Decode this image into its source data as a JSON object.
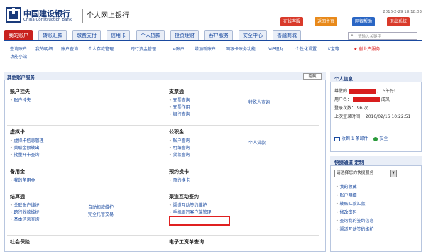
{
  "header": {
    "bank_cn": "中国建设银行",
    "bank_en": "China Construction Bank",
    "system_title": "个人网上银行",
    "date": "2016-2-29 18:18:03",
    "buttons": [
      "在线客服",
      "返回主页",
      "网银帮助",
      "退出系统"
    ]
  },
  "nav": {
    "tabs": [
      "我的账户",
      "转账汇款",
      "缴费支付",
      "信用卡",
      "个人贷款",
      "投资理财",
      "客户服务",
      "安全中心",
      "善融商城"
    ],
    "search_placeholder": "请输入关键字"
  },
  "subnav": {
    "items": [
      "查询账户",
      "我的明细",
      "账户查询",
      "个人存款管理",
      "跨行资金管理",
      "e账户",
      "增加新账户",
      "网银卡账务功能",
      "VIP理财",
      "个性化设置",
      "K宝等",
      "★ 创业产服务",
      "功能小站"
    ]
  },
  "main": {
    "title": "其他账户服务",
    "toggle_label": "隐藏",
    "sections": [
      {
        "title": "账户挂失",
        "links": [
          "账户挂失"
        ]
      },
      {
        "title": "支票通",
        "links": [
          "支票查询",
          "支票作用",
          "银行查询",
          "特殊人查询"
        ]
      },
      {
        "title": "虚拟卡",
        "links": [
          "虚拟卡信息管理",
          "关联金额转出",
          "批量开卡查询"
        ]
      },
      {
        "title": "公积金",
        "links": [
          "账户查询",
          "明细查询",
          "贷款查询",
          "个人贷款"
        ]
      },
      {
        "title": "备用金",
        "links": [
          "我的备用金"
        ]
      },
      {
        "title": "预约换卡",
        "links": [
          "预约换卡"
        ]
      },
      {
        "title": "结算通",
        "links": [
          "关联账户维护",
          "跨行收款维护",
          "基本信息查询",
          "自动扣款维护",
          "完全托管交易"
        ]
      },
      {
        "title": "渠道互动签约",
        "links": [
          "渠道互动签约维护",
          "手机银行客户端管理"
        ]
      },
      {
        "title": "社会保险",
        "links": []
      },
      {
        "title": "电子工资单查询",
        "links": []
      }
    ]
  },
  "user_info": {
    "title": "个人信息",
    "greeting_label": "尊敬的",
    "greeting_suffix": "，下午好!",
    "username_label": "用户名：",
    "username_suffix": "成凤",
    "login_count": "登录次数： 96 次",
    "last_login": "上次登录时间： 2016/02/16 10:22:51",
    "actions": [
      "收到 1 条邮件",
      "安全"
    ]
  },
  "quick": {
    "title": "快捷通道   定制",
    "select_value": "请选择您的快捷服务",
    "links": [
      "我的收藏",
      "账户明细",
      "转账汇款汇款",
      "修改密码",
      "查询我的签约信息",
      "渠道互动签约维护"
    ]
  },
  "colors": {
    "brand": "#1a4aa0",
    "accent_red": "#c8211e",
    "highlight": "#e02020"
  }
}
